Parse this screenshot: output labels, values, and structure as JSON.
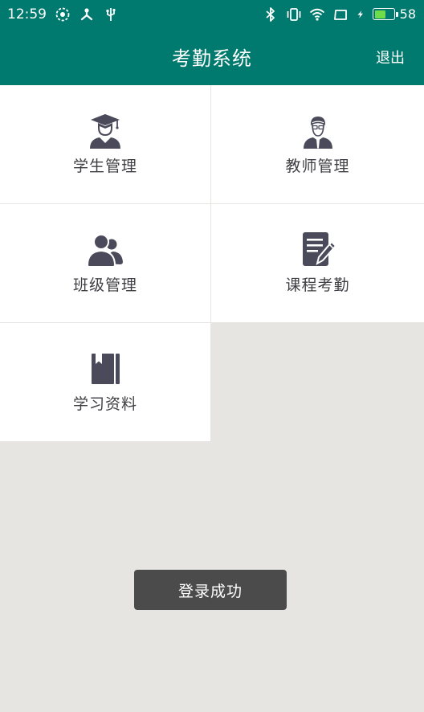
{
  "status_bar": {
    "time": "12:59",
    "battery_percent": "58",
    "battery_level": 0.58,
    "left_icons": [
      "sync-icon",
      "usb-tree-icon",
      "usb-icon"
    ],
    "right_icons": [
      "bluetooth-icon",
      "vibrate-icon",
      "wifi-icon",
      "screen-icon",
      "charging-icon",
      "battery-icon"
    ]
  },
  "app_bar": {
    "title": "考勤系统",
    "logout_label": "退出"
  },
  "menu": {
    "items": [
      {
        "label": "学生管理",
        "icon": "student-graduate-icon"
      },
      {
        "label": "教师管理",
        "icon": "teacher-icon"
      },
      {
        "label": "班级管理",
        "icon": "class-group-icon"
      },
      {
        "label": "课程考勤",
        "icon": "course-attendance-icon"
      },
      {
        "label": "学习资料",
        "icon": "study-material-book-icon"
      }
    ]
  },
  "toast": {
    "message": "登录成功"
  },
  "colors": {
    "primary": "#007a6e",
    "background": "#e6e5e1",
    "tile": "#ffffff",
    "icon": "#4a4a5a",
    "toast": "#4b4b4b",
    "battery_fill": "#6fdb4a"
  }
}
